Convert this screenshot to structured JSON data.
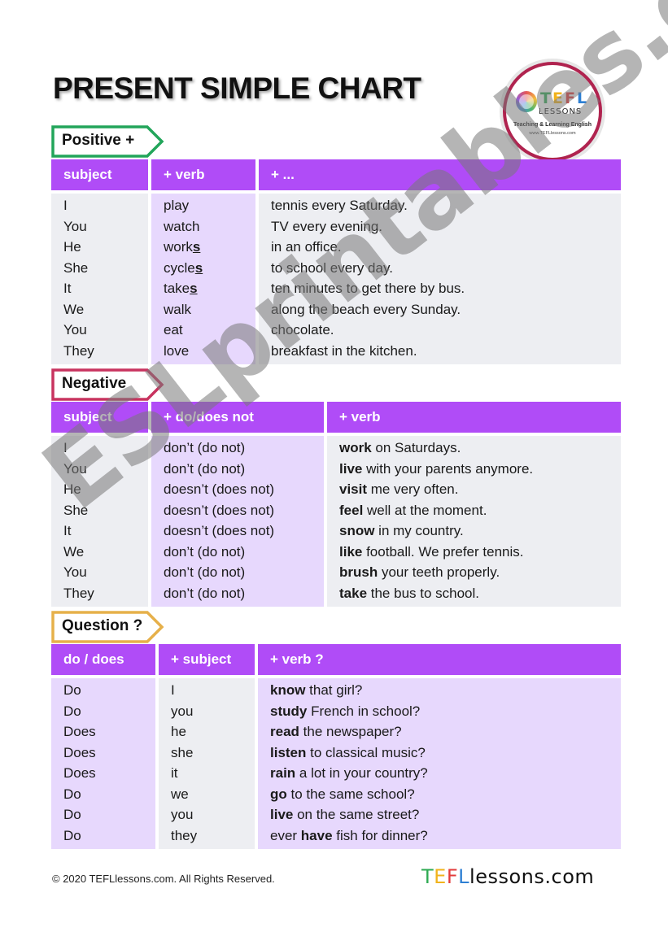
{
  "title": "PRESENT SIMPLE CHART",
  "logo": {
    "tefl_letters": [
      "T",
      "E",
      "F",
      "L"
    ],
    "tefl_colors": [
      "#2eaa52",
      "#f1b31c",
      "#e23b3b",
      "#2d7fd3"
    ],
    "lessons": "LESSONS",
    "tagline": "Teaching & Learning English",
    "url": "www.TEFLlessons.com",
    "ring_color": "#b0234f"
  },
  "colors": {
    "header_purple": "#b04cf7",
    "lavender": "#e7d8fd",
    "gray": "#edeef2",
    "positive_tag": "#22a55a",
    "negative_tag": "#c8335f",
    "question_tag": "#e6b04a"
  },
  "positive": {
    "tag": "Positive +",
    "headers": [
      "subject",
      "+ verb",
      "+ ..."
    ],
    "rows": [
      {
        "subject": "I",
        "verb": "play",
        "verb_suffix": "",
        "rest": "tennis every Saturday."
      },
      {
        "subject": "You",
        "verb": "watch",
        "verb_suffix": "",
        "rest": "TV every evening."
      },
      {
        "subject": "He",
        "verb": "work",
        "verb_suffix": "s",
        "rest": "in an office."
      },
      {
        "subject": "She",
        "verb": "cycle",
        "verb_suffix": "s",
        "rest": "to school every day."
      },
      {
        "subject": "It",
        "verb": "take",
        "verb_suffix": "s",
        "rest": "ten minutes to get there by bus."
      },
      {
        "subject": "We",
        "verb": "walk",
        "verb_suffix": "",
        "rest": "along the beach every Sunday."
      },
      {
        "subject": "You",
        "verb": "eat",
        "verb_suffix": "",
        "rest": "chocolate."
      },
      {
        "subject": "They",
        "verb": "love",
        "verb_suffix": "",
        "rest": "breakfast in the kitchen."
      }
    ]
  },
  "negative": {
    "tag": "Negative",
    "headers": [
      "subject",
      "+ do/does not",
      "+ verb"
    ],
    "rows": [
      {
        "subject": "I",
        "aux": "don’t (do not)",
        "verb": "work",
        "rest": " on Saturdays."
      },
      {
        "subject": "You",
        "aux": "don’t (do not)",
        "verb": "live",
        "rest": " with your parents anymore."
      },
      {
        "subject": "He",
        "aux": "doesn’t (does not)",
        "verb": "visit",
        "rest": " me very often."
      },
      {
        "subject": "She",
        "aux": "doesn’t (does not)",
        "verb": "feel",
        "rest": " well at the moment."
      },
      {
        "subject": "It",
        "aux": "doesn’t (does not)",
        "verb": "snow",
        "rest": " in my country."
      },
      {
        "subject": "We",
        "aux": "don’t (do not)",
        "verb": "like",
        "rest": " football. We prefer tennis."
      },
      {
        "subject": "You",
        "aux": "don’t (do not)",
        "verb": "brush",
        "rest": " your teeth properly."
      },
      {
        "subject": "They",
        "aux": "don’t (do not)",
        "verb": "take",
        "rest": " the bus to school."
      }
    ]
  },
  "question": {
    "tag": "Question ?",
    "headers": [
      "do / does",
      "+ subject",
      "+ verb ?"
    ],
    "rows": [
      {
        "aux": "Do",
        "subject": "I",
        "pre": "",
        "verb": "know",
        "rest": " that girl?"
      },
      {
        "aux": "Do",
        "subject": "you",
        "pre": "",
        "verb": "study",
        "rest": " French in school?"
      },
      {
        "aux": "Does",
        "subject": "he",
        "pre": "",
        "verb": "read",
        "rest": " the newspaper?"
      },
      {
        "aux": "Does",
        "subject": "she",
        "pre": "",
        "verb": "listen",
        "rest": " to classical music?"
      },
      {
        "aux": "Does",
        "subject": "it",
        "pre": "",
        "verb": "rain",
        "rest": " a lot in your country?"
      },
      {
        "aux": "Do",
        "subject": "we",
        "pre": "",
        "verb": "go",
        "rest": " to the same school?"
      },
      {
        "aux": "Do",
        "subject": "you",
        "pre": "",
        "verb": "live",
        "rest": " on the same street?"
      },
      {
        "aux": "Do",
        "subject": "they",
        "pre": "ever ",
        "verb": "have",
        "rest": " fish for dinner?"
      }
    ]
  },
  "watermark": "ESLprintables.com",
  "footer": {
    "copyright": "© 2020 TEFLlessons.com. All Rights Reserved.",
    "logo_letters": [
      "T",
      "E",
      "F",
      "L"
    ],
    "logo_rest": "lessons.com"
  }
}
